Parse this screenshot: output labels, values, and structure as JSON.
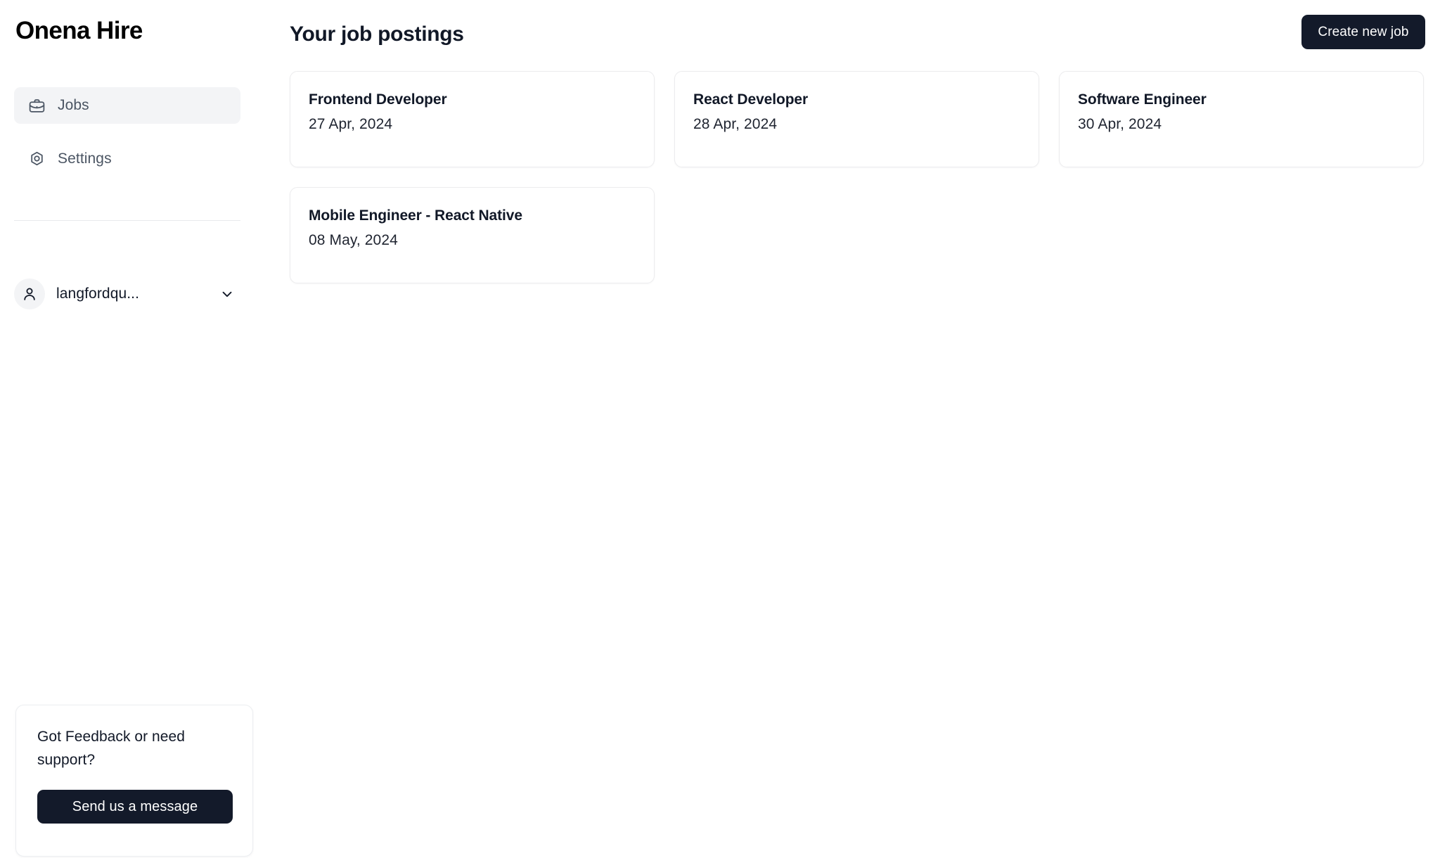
{
  "brand": {
    "name": "Onena Hire"
  },
  "colors": {
    "accent_dark": "#131a2a",
    "active_nav_bg": "#f3f4f6",
    "card_border": "#ececee",
    "text_primary": "#111827",
    "text_muted": "#4b5563"
  },
  "sidebar": {
    "items": [
      {
        "label": "Jobs",
        "icon": "briefcase-icon",
        "active": true
      },
      {
        "label": "Settings",
        "icon": "settings-nut-icon",
        "active": false
      }
    ],
    "user": {
      "name": "langfordqu...",
      "avatar_icon": "user-icon",
      "chevron_icon": "chevron-down-icon"
    },
    "feedback": {
      "text": "Got Feedback or need support?",
      "button_label": "Send us a message"
    }
  },
  "main": {
    "title": "Your job postings",
    "create_button_label": "Create new job",
    "jobs": [
      {
        "title": "Frontend Developer",
        "date": "27 Apr, 2024"
      },
      {
        "title": "React Developer",
        "date": "28 Apr, 2024"
      },
      {
        "title": "Software Engineer",
        "date": "30 Apr, 2024"
      },
      {
        "title": "Mobile Engineer - React Native",
        "date": "08 May, 2024"
      }
    ]
  }
}
